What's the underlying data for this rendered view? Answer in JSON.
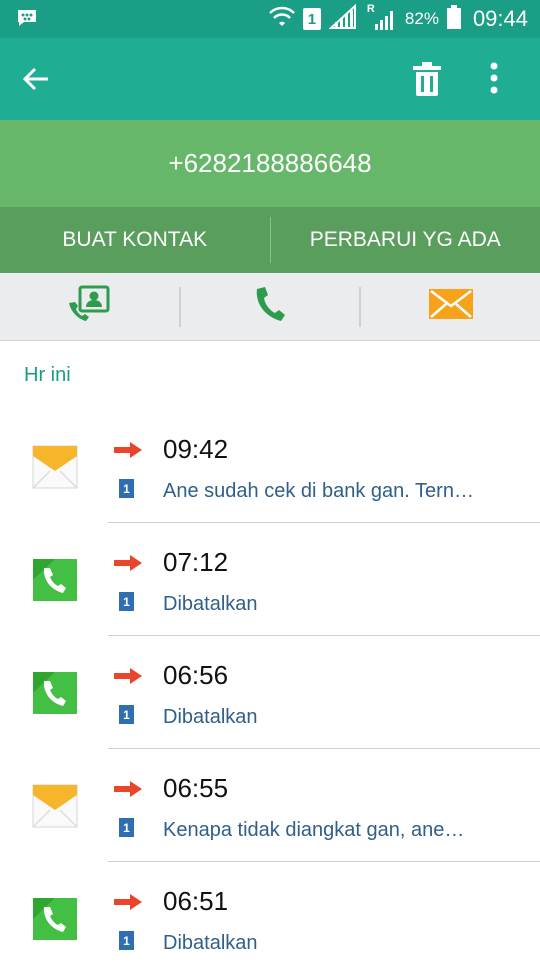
{
  "status_bar": {
    "sim_badge": "1",
    "roaming": "R",
    "battery_percent": "82%",
    "time": "09:44"
  },
  "header": {
    "phone_number": "+6282188886648"
  },
  "actions": {
    "create_contact": "BUAT KONTAK",
    "update_existing": "PERBARUI YG ADA"
  },
  "section_label": "Hr ini",
  "log": [
    {
      "type": "message",
      "direction": "outgoing",
      "time": "09:42",
      "sim": "1",
      "detail": "Ane sudah cek di bank gan. Tern…"
    },
    {
      "type": "call",
      "direction": "outgoing",
      "time": "07:12",
      "sim": "1",
      "detail": "Dibatalkan"
    },
    {
      "type": "call",
      "direction": "outgoing",
      "time": "06:56",
      "sim": "1",
      "detail": "Dibatalkan"
    },
    {
      "type": "message",
      "direction": "outgoing",
      "time": "06:55",
      "sim": "1",
      "detail": "Kenapa tidak diangkat gan, ane…"
    },
    {
      "type": "call",
      "direction": "outgoing",
      "time": "06:51",
      "sim": "1",
      "detail": "Dibatalkan"
    }
  ],
  "colors": {
    "status_bar": "#1b9e86",
    "app_bar": "#1fae93",
    "number_bar": "#67b76b",
    "action_bar": "#5a9e5d",
    "accent_text": "#1a9d86",
    "outgoing_arrow": "#e8452c",
    "message_icon": "#f7b52c",
    "call_icon": "#3fb53f"
  }
}
